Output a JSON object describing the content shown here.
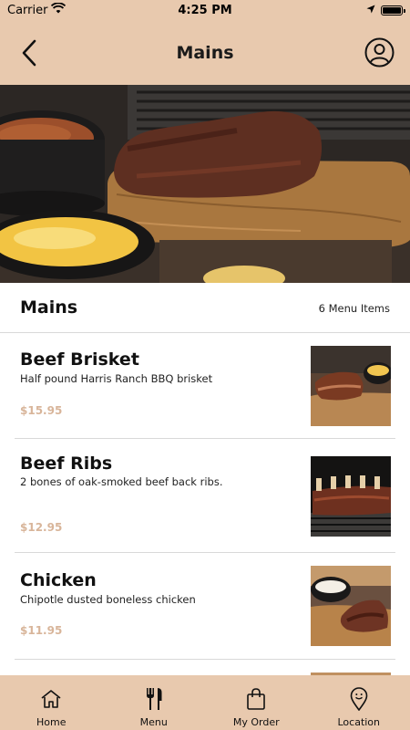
{
  "status_bar": {
    "carrier": "Carrier",
    "time": "4:25 PM"
  },
  "header": {
    "title": "Mains"
  },
  "section": {
    "title": "Mains",
    "count_label": "6 Menu Items"
  },
  "menu_items": [
    {
      "name": "Beef Brisket",
      "description": "Half pound Harris Ranch BBQ brisket",
      "price": "$15.95"
    },
    {
      "name": "Beef Ribs",
      "description": "2 bones of oak-smoked beef back ribs.",
      "price": "$12.95"
    },
    {
      "name": "Chicken",
      "description": "Chipotle dusted boneless chicken",
      "price": "$11.95"
    }
  ],
  "tabs": [
    {
      "label": "Home",
      "icon": "home-icon"
    },
    {
      "label": "Menu",
      "icon": "utensils-icon"
    },
    {
      "label": "My Order",
      "icon": "shopping-bag-icon"
    },
    {
      "label": "Location",
      "icon": "location-pin-icon"
    }
  ],
  "colors": {
    "header_bg": "#e8c9ae",
    "price": "#d8b59a",
    "divider": "#d9d9d9"
  }
}
